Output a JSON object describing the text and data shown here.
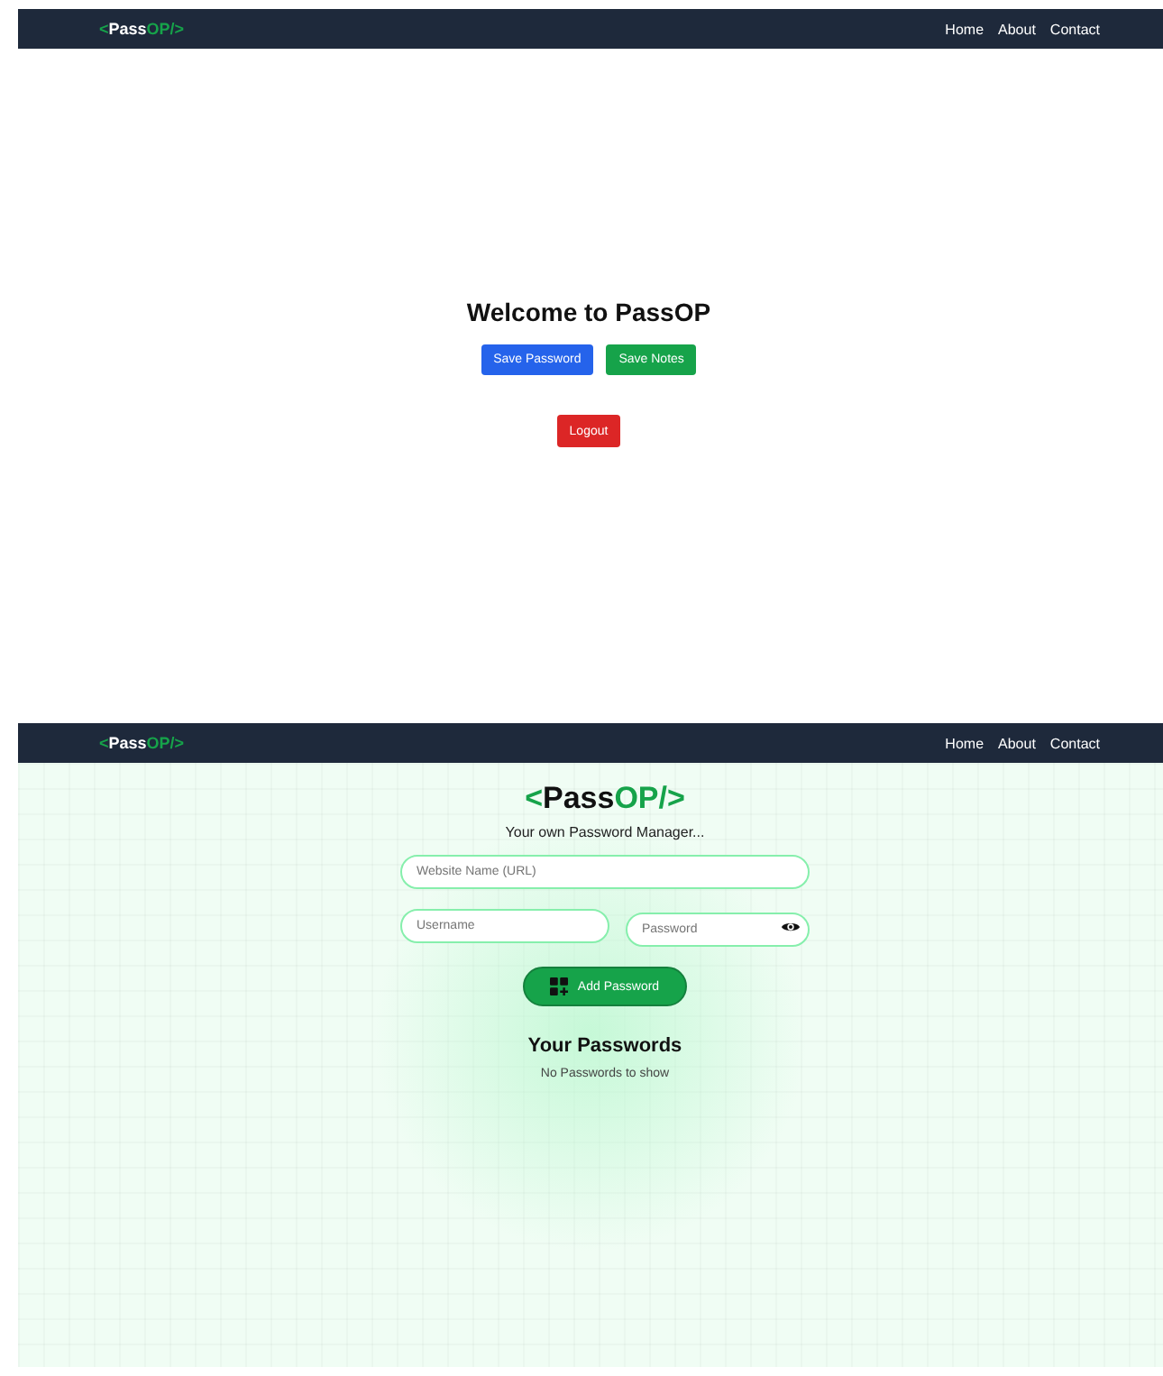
{
  "home_screen": {
    "navbar": {
      "logo": {
        "open": "<",
        "name": "Pass",
        "accent": "OP/>"
      },
      "links": [
        "Home",
        "About",
        "Contact"
      ]
    },
    "heading": "Welcome to PassOP",
    "buttons": [
      {
        "label": "Save Password",
        "kind": "primary"
      },
      {
        "label": "Save Notes",
        "kind": "success"
      }
    ],
    "logout_button": {
      "label": "Logout",
      "kind": "danger"
    }
  },
  "manager_screen": {
    "navbar": {
      "logo": {
        "open": "<",
        "name": "Pass",
        "accent": "OP/>"
      },
      "links": [
        "Home",
        "About",
        "Contact"
      ]
    },
    "title": {
      "open": "<",
      "name": "Pass",
      "accent": "OP/>"
    },
    "subtitle": "Your own Password Manager...",
    "website_field": {
      "placeholder": "Website Name (URL)"
    },
    "username_field": {
      "placeholder": "Username"
    },
    "password_field": {
      "placeholder": "Password"
    },
    "add_button": "Add Password",
    "passwords_heading": "Your Passwords",
    "empty_message": "No Passwords to show"
  }
}
